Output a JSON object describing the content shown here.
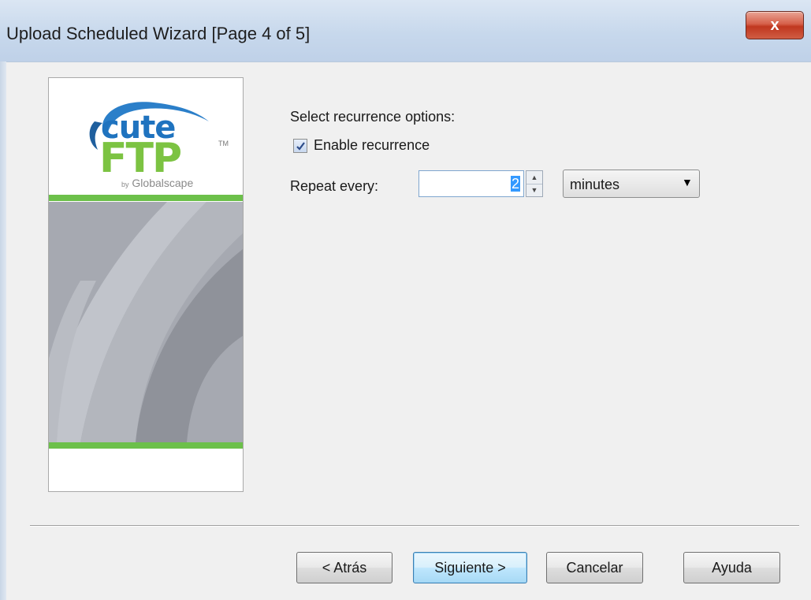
{
  "window": {
    "title": "Upload Scheduled Wizard [Page 4 of 5]",
    "close_glyph": "x"
  },
  "sidebar": {
    "logo_cute": "cute",
    "logo_ftp": "FTP",
    "logo_tm": "TM",
    "logo_by": "by",
    "logo_company": "Globalscape",
    "accent_green": "#6cc04a",
    "accent_blue": "#1f73bf"
  },
  "recurrence": {
    "heading": "Select recurrence options:",
    "enable_checked": true,
    "enable_label": "Enable recurrence",
    "repeat_label": "Repeat every:",
    "repeat_value": "2",
    "unit_selected": "minutes"
  },
  "buttons": {
    "back": "< Atrás",
    "next": "Siguiente >",
    "cancel": "Cancelar",
    "help": "Ayuda"
  }
}
